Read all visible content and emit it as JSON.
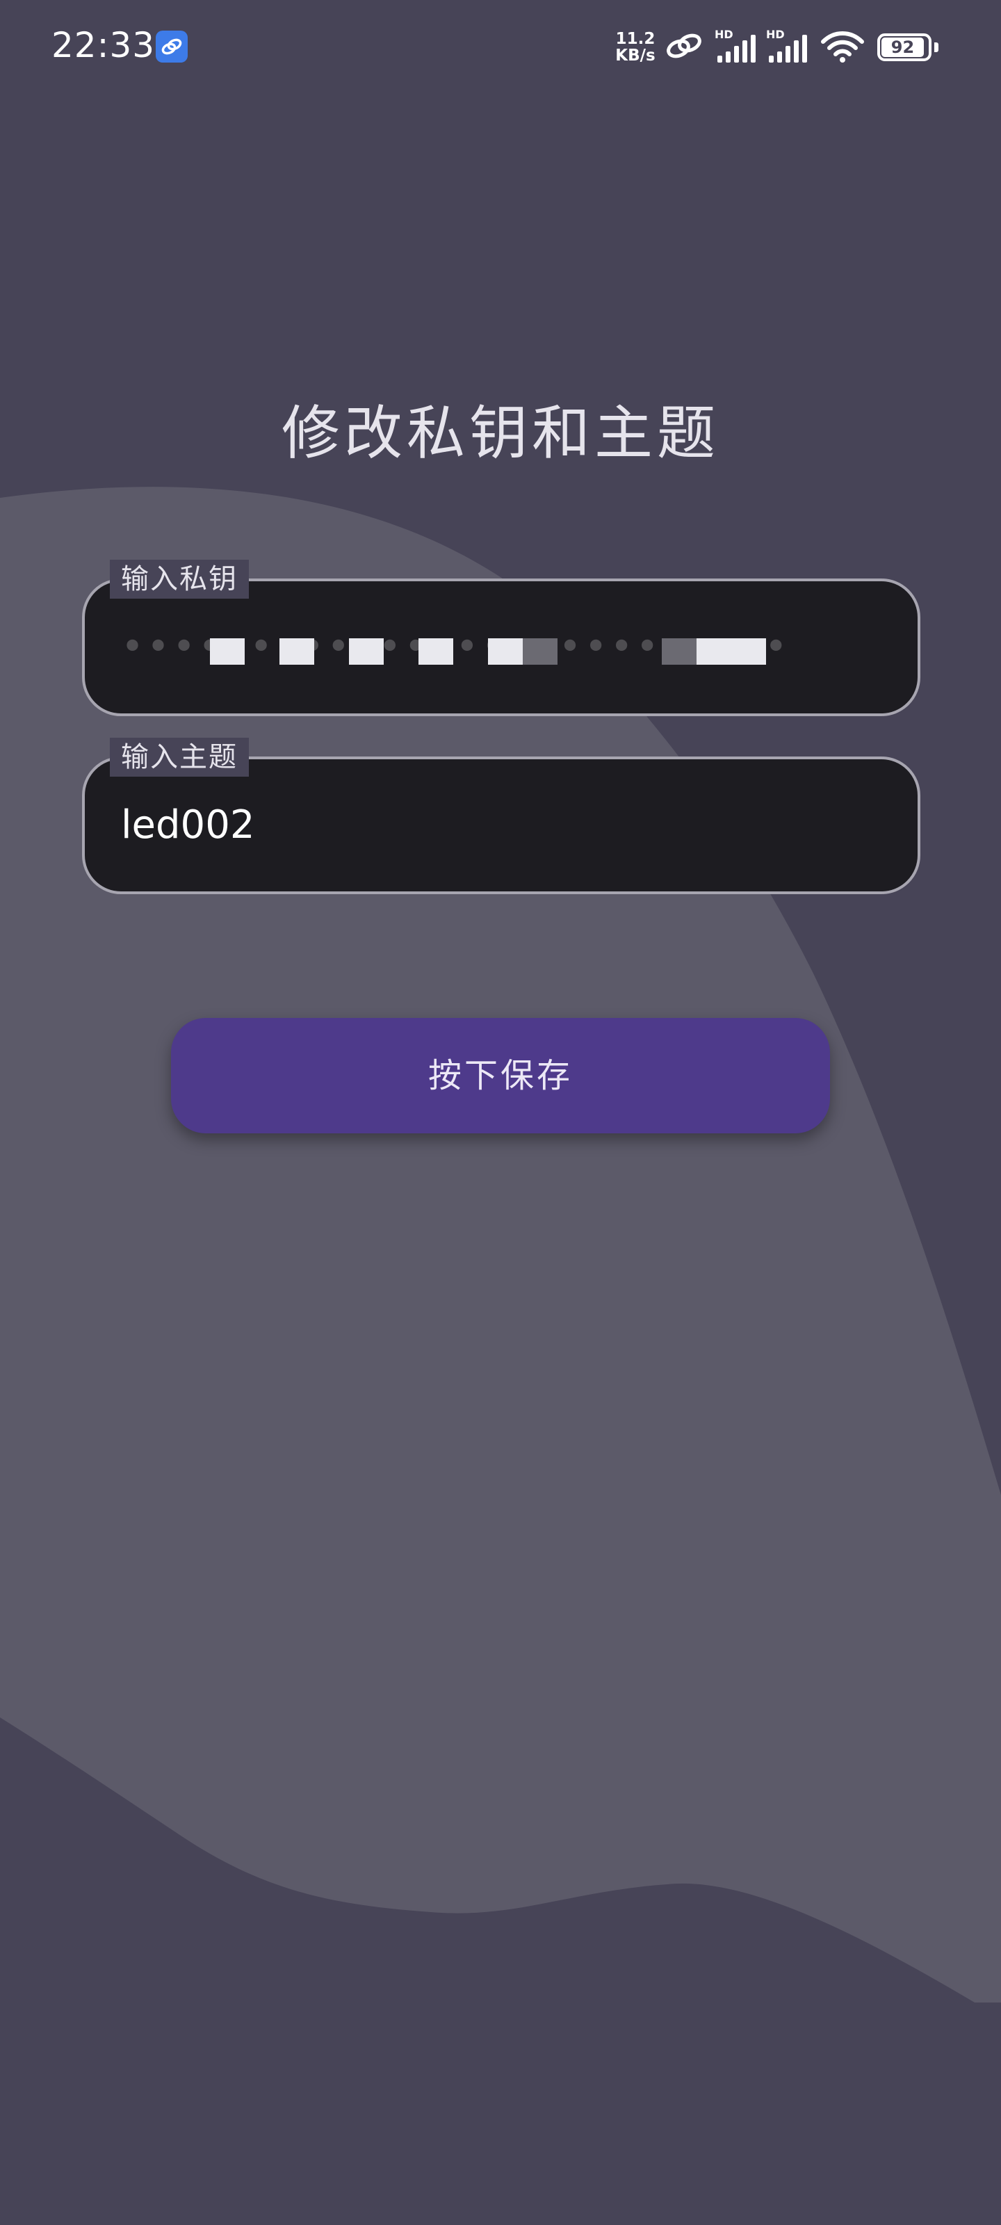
{
  "status_bar": {
    "time": "22:33",
    "app_icon": "link-icon",
    "net_speed_value": "11.2",
    "net_speed_unit": "KB/s",
    "hd_label_1": "HD",
    "hd_label_2": "HD",
    "battery": "92",
    "icons": [
      "link-icon",
      "signal-icon",
      "signal-icon",
      "wifi-icon",
      "battery-icon"
    ]
  },
  "page": {
    "title": "修改私钥和主题"
  },
  "form": {
    "key_label": "输入私钥",
    "key_value_redacted": true,
    "topic_label": "输入主题",
    "topic_value": "led002",
    "save_label": "按下保存"
  },
  "colors": {
    "background": "#474457",
    "wave": "#5c5a69",
    "field_bg": "#1d1c21",
    "field_border": "#a7a5b0",
    "button": "#4e3a8b"
  }
}
